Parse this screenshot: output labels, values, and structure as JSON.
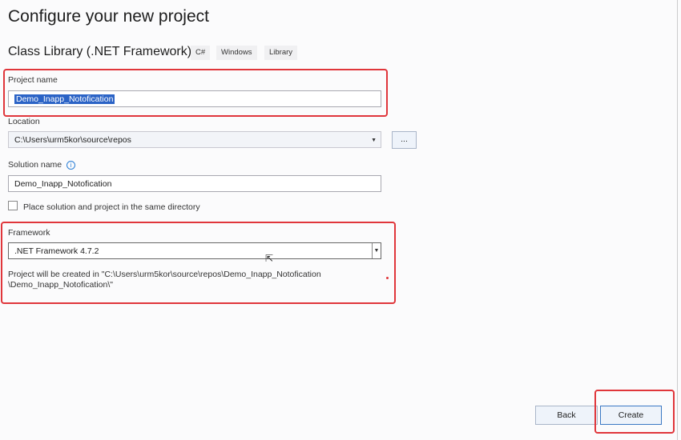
{
  "page_title": "Configure your new project",
  "template_name": "Class Library (.NET Framework)",
  "tags": [
    "C#",
    "Windows",
    "Library"
  ],
  "project_name": {
    "label": "Project name",
    "value": "Demo_Inapp_Notofication"
  },
  "location": {
    "label": "Location",
    "value": "C:\\Users\\urm5kor\\source\\repos",
    "browse_label": "..."
  },
  "solution_name": {
    "label": "Solution name",
    "value": "Demo_Inapp_Notofication"
  },
  "same_directory": {
    "label": "Place solution and project in the same directory",
    "checked": false
  },
  "framework": {
    "label": "Framework",
    "value": ".NET Framework 4.7.2"
  },
  "path_info_line1": "Project will be created in \"C:\\Users\\urm5kor\\source\\repos\\Demo_Inapp_Notofication",
  "path_info_line2": "\\Demo_Inapp_Notofication\\\"",
  "buttons": {
    "back": "Back",
    "create": "Create"
  }
}
